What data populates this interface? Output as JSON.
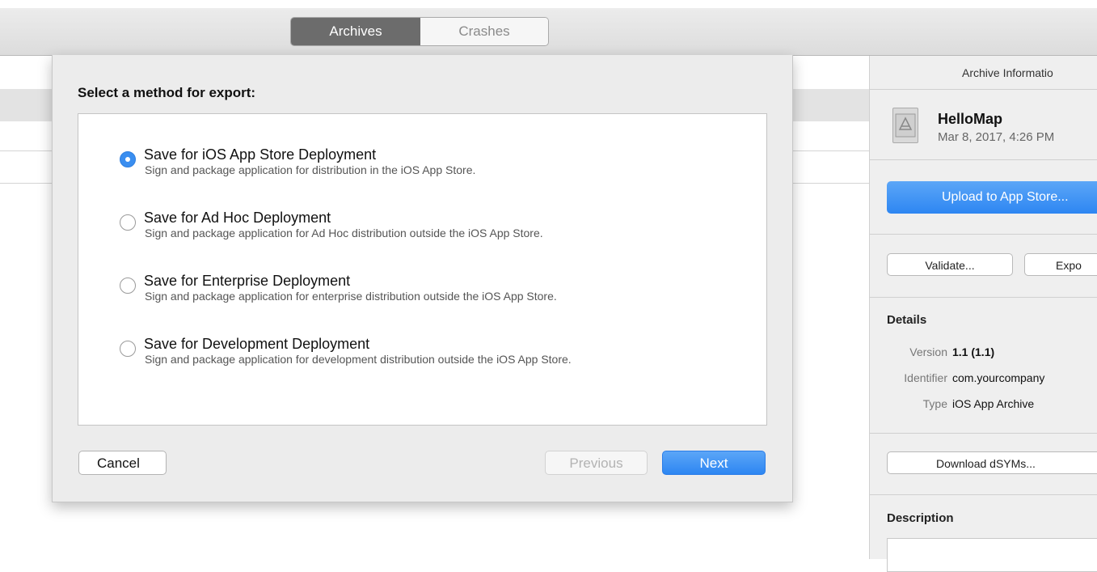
{
  "toolbar": {
    "tabs": [
      {
        "label": "Archives",
        "selected": true
      },
      {
        "label": "Crashes",
        "selected": false
      }
    ]
  },
  "sheet": {
    "title": "Select a method for export:",
    "options": [
      {
        "label": "Save for iOS App Store Deployment",
        "description": "Sign and package application for distribution in the iOS App Store.",
        "selected": true
      },
      {
        "label": "Save for Ad Hoc Deployment",
        "description": "Sign and package application for Ad Hoc distribution outside the iOS App Store.",
        "selected": false
      },
      {
        "label": "Save for Enterprise Deployment",
        "description": "Sign and package application for enterprise distribution outside the iOS App Store.",
        "selected": false
      },
      {
        "label": "Save for Development Deployment",
        "description": "Sign and package application for development distribution outside the iOS App Store.",
        "selected": false
      }
    ],
    "cancel_label": "Cancel",
    "previous_label": "Previous",
    "next_label": "Next"
  },
  "inspector": {
    "title": "Archive Informatio",
    "app_name": "HelloMap",
    "app_date": "Mar 8, 2017, 4:26 PM",
    "upload_label": "Upload to App Store...",
    "validate_label": "Validate...",
    "export_label": "Expo",
    "details_heading": "Details",
    "details": [
      {
        "key": "Version",
        "value": "1.1 (1.1)"
      },
      {
        "key": "Identifier",
        "value": "com.yourcompany"
      },
      {
        "key": "Type",
        "value": "iOS App Archive"
      }
    ],
    "download_label": "Download dSYMs...",
    "description_heading": "Description"
  },
  "colors": {
    "accent": "#2d86f2",
    "segment_selected": "#6c6c6c"
  }
}
